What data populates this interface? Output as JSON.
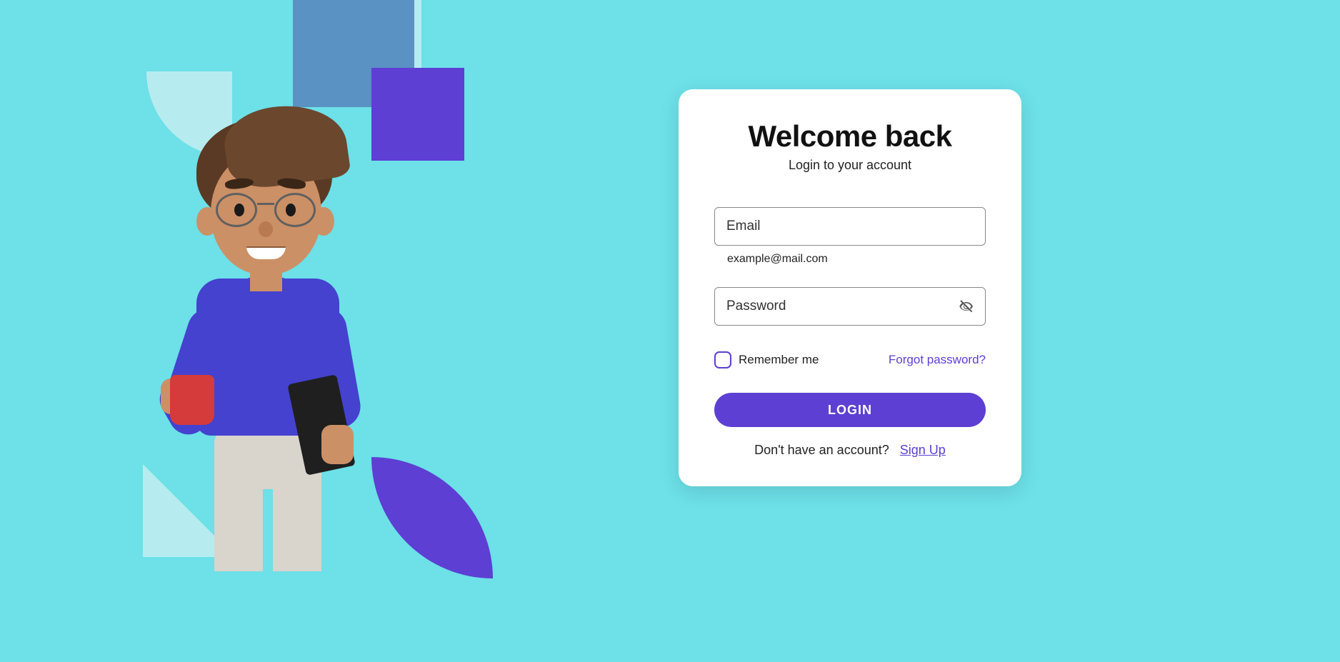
{
  "card": {
    "title": "Welcome back",
    "subtitle": "Login to your account",
    "email": {
      "placeholder": "Email",
      "helper": "example@mail.com",
      "value": ""
    },
    "password": {
      "placeholder": "Password",
      "value": ""
    },
    "remember_label": "Remember me",
    "forgot_label": "Forgot password?",
    "login_button": "LOGIN",
    "signup_prompt": "Don't have an account?",
    "signup_link": "Sign Up"
  },
  "colors": {
    "accent": "#5d3fd3",
    "background": "#6de0e8"
  }
}
